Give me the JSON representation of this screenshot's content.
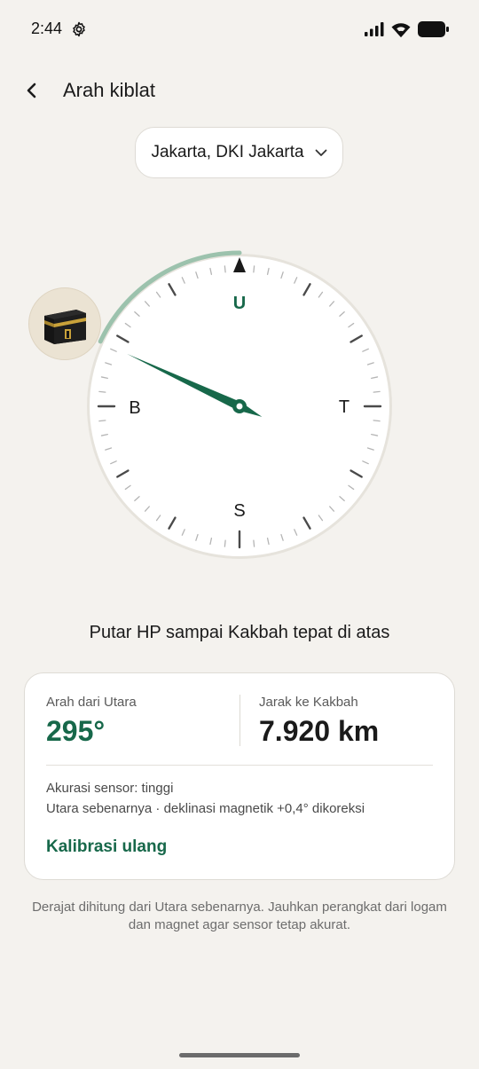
{
  "status_bar": {
    "time": "2:44"
  },
  "header": {
    "title": "Arah kiblat"
  },
  "location": {
    "label": "Jakarta, DKI Jakarta"
  },
  "compass": {
    "north_label": "U",
    "east_label": "T",
    "south_label": "S",
    "west_label": "B",
    "qibla_bearing_deg": 295,
    "accent_color": "#17684a"
  },
  "instruction": "Putar HP sampai Kakbah tepat di atas",
  "card": {
    "direction_label": "Arah dari Utara",
    "direction_value": "295°",
    "distance_label": "Jarak ke Kakbah",
    "distance_value": "7.920 km",
    "accuracy": "Akurasi sensor: tinggi",
    "declination": "Utara sebenarnya · deklinasi magnetik +0,4° dikoreksi",
    "recalibrate_label": "Kalibrasi ulang"
  },
  "footnote": "Derajat dihitung dari Utara sebenarnya. Jauhkan perangkat dari logam dan magnet agar sensor tetap akurat."
}
